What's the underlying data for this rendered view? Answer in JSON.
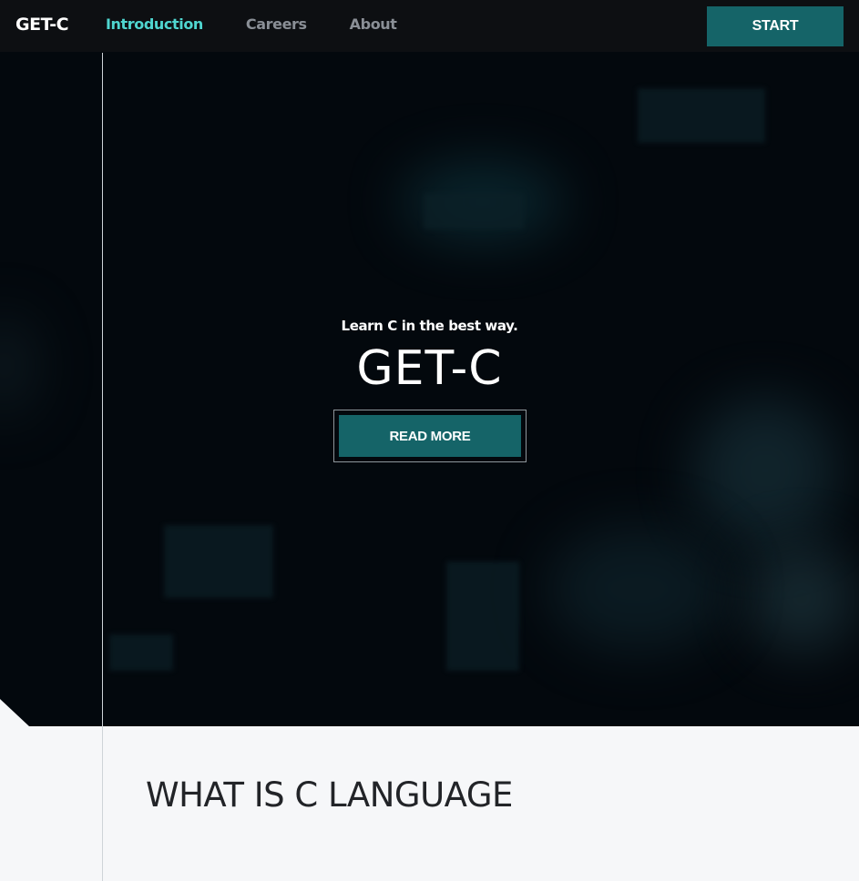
{
  "nav": {
    "brand": "GET-C",
    "links": [
      {
        "label": "Introduction",
        "active": true
      },
      {
        "label": "Careers",
        "active": false
      },
      {
        "label": "About",
        "active": false
      }
    ],
    "start_label": "START"
  },
  "hero": {
    "tagline": "Learn C in the best way.",
    "title": "GET-C",
    "read_more_label": "READ MORE"
  },
  "section": {
    "title": "WHAT IS C LANGUAGE"
  },
  "colors": {
    "accent": "#156468",
    "active_link": "#4fd6d0",
    "nav_bg": "#0d0f12",
    "hero_bg": "#03080d",
    "section_bg": "#f6f7f9"
  }
}
